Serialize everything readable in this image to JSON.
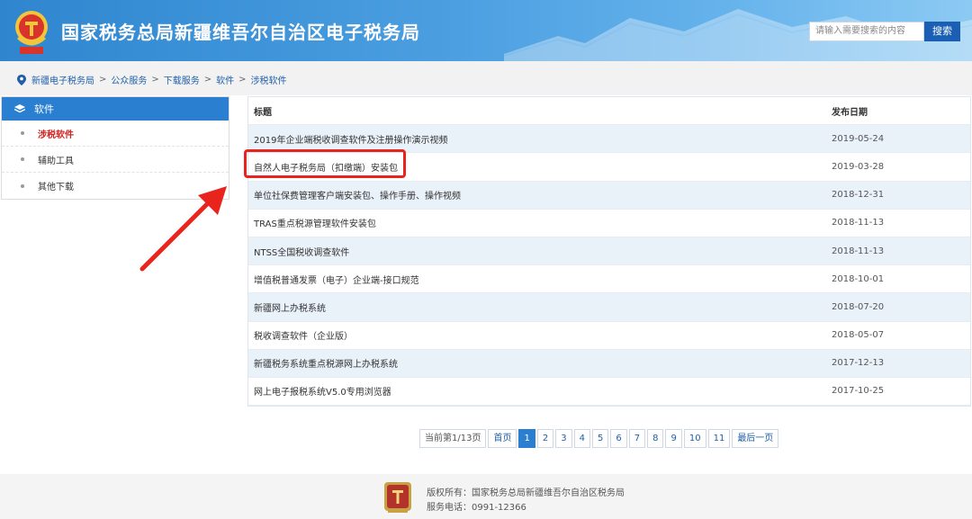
{
  "header": {
    "site_title": "国家税务总局新疆维吾尔自治区电子税务局",
    "search_placeholder": "请输入需要搜索的内容",
    "search_button": "搜索"
  },
  "breadcrumb": [
    "新疆电子税务局",
    "公众服务",
    "下载服务",
    "软件",
    "涉税软件"
  ],
  "sidebar": {
    "heading": "软件",
    "items": [
      {
        "label": "涉税软件",
        "active": true
      },
      {
        "label": "辅助工具",
        "active": false
      },
      {
        "label": "其他下载",
        "active": false
      }
    ]
  },
  "table": {
    "columns": [
      "标题",
      "发布日期"
    ],
    "rows": [
      {
        "title": "2019年企业端税收调查软件及注册操作演示视频",
        "date": "2019-05-24"
      },
      {
        "title": "自然人电子税务局（扣缴端）安装包",
        "date": "2019-03-28"
      },
      {
        "title": "单位社保费管理客户端安装包、操作手册、操作视频",
        "date": "2018-12-31"
      },
      {
        "title": "TRAS重点税源管理软件安装包",
        "date": "2018-11-13"
      },
      {
        "title": "NTSS全国税收调查软件",
        "date": "2018-11-13"
      },
      {
        "title": "增值税普通发票（电子）企业端-接口规范",
        "date": "2018-10-01"
      },
      {
        "title": "新疆网上办税系统",
        "date": "2018-07-20"
      },
      {
        "title": "税收调查软件（企业版）",
        "date": "2018-05-07"
      },
      {
        "title": "新疆税务系统重点税源网上办税系统",
        "date": "2017-12-13"
      },
      {
        "title": "网上电子报税系统V5.0专用浏览器",
        "date": "2017-10-25"
      }
    ]
  },
  "pagination": {
    "info": "当前第1/13页",
    "first": "首页",
    "pages": [
      "1",
      "2",
      "3",
      "4",
      "5",
      "6",
      "7",
      "8",
      "9",
      "10",
      "11"
    ],
    "current": "1",
    "last": "最后一页"
  },
  "footer": {
    "copyright": "版权所有：国家税务总局新疆维吾尔自治区税务局",
    "phone": "服务电话：0991-12366"
  },
  "colors": {
    "header_blue": "#2f86cf",
    "accent_blue": "#2b7fd1",
    "active_red": "#d32020",
    "annotation_red": "#e8241c",
    "row_alt": "#e9f1f9"
  },
  "icons": [
    "tax-emblem-icon",
    "location-pin-icon",
    "layers-icon",
    "annotation-arrow"
  ]
}
